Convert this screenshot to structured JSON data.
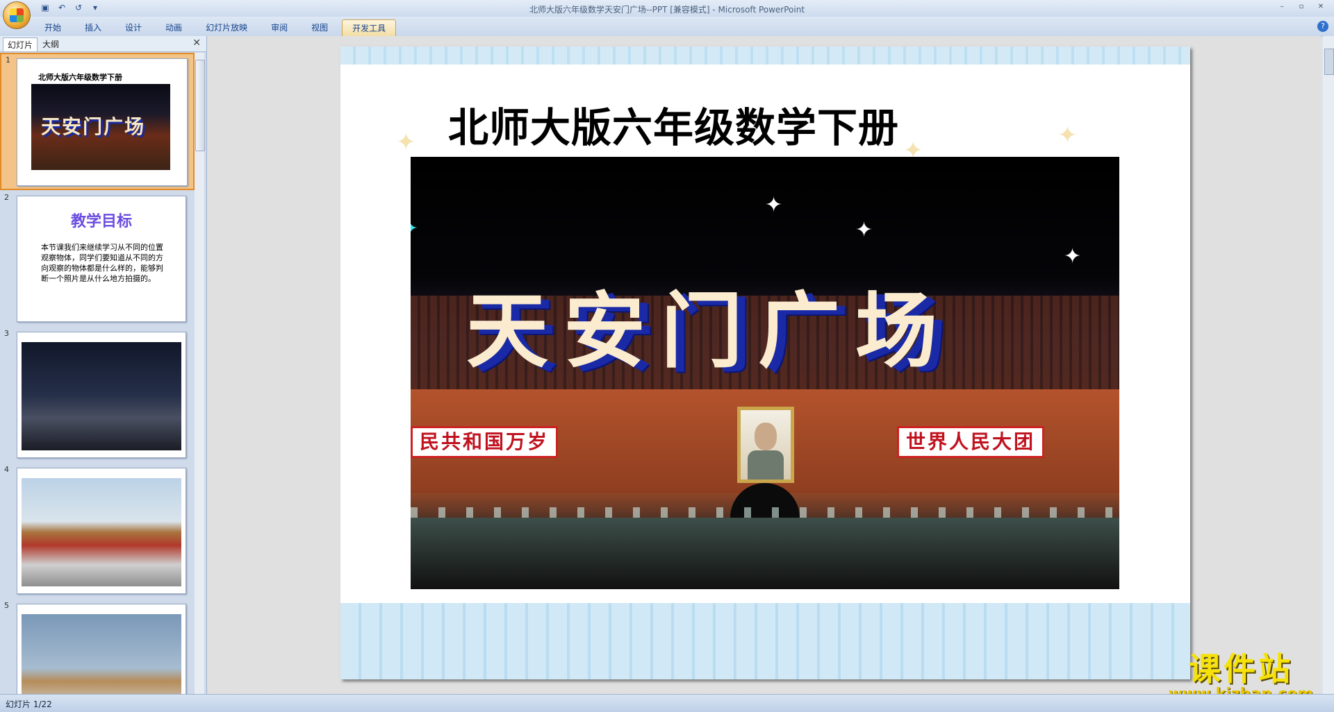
{
  "window": {
    "title": "北师大版六年级数学天安门广场--PPT [兼容模式] - Microsoft PowerPoint",
    "minimize": "–",
    "maximize": "▫",
    "close": "✕"
  },
  "quick_access": {
    "save": "▣",
    "undo": "↶",
    "redo": "↺",
    "more": "▾"
  },
  "ribbon": {
    "tabs": [
      "开始",
      "插入",
      "设计",
      "动画",
      "幻灯片放映",
      "审阅",
      "视图",
      "开发工具"
    ],
    "active_tab_index": 7,
    "help": "?"
  },
  "panel": {
    "tabs": {
      "slides": "幻灯片",
      "outline": "大纲"
    },
    "close": "✕",
    "thumbnails": [
      {
        "number": "1",
        "title": "北师大版六年级数学下册",
        "art": "天安门广场"
      },
      {
        "number": "2",
        "title": "教学目标",
        "body": "本节课我们来继续学习从不同的位置观察物体，同学们要知道从不同的方向观察的物体都是什么样的，能够判断一个照片是从什么地方拍摄的。"
      },
      {
        "number": "3"
      },
      {
        "number": "4"
      },
      {
        "number": "5"
      }
    ]
  },
  "slide": {
    "title": "北师大版六年级数学下册",
    "photo_art": "天安门广场",
    "banner_left": "民共和国万岁",
    "banner_right": "世界人民大团"
  },
  "watermark": {
    "title": "课件站",
    "url": "www.kjzhan.com"
  },
  "status": {
    "slide_counter": "幻灯片 1/22"
  }
}
